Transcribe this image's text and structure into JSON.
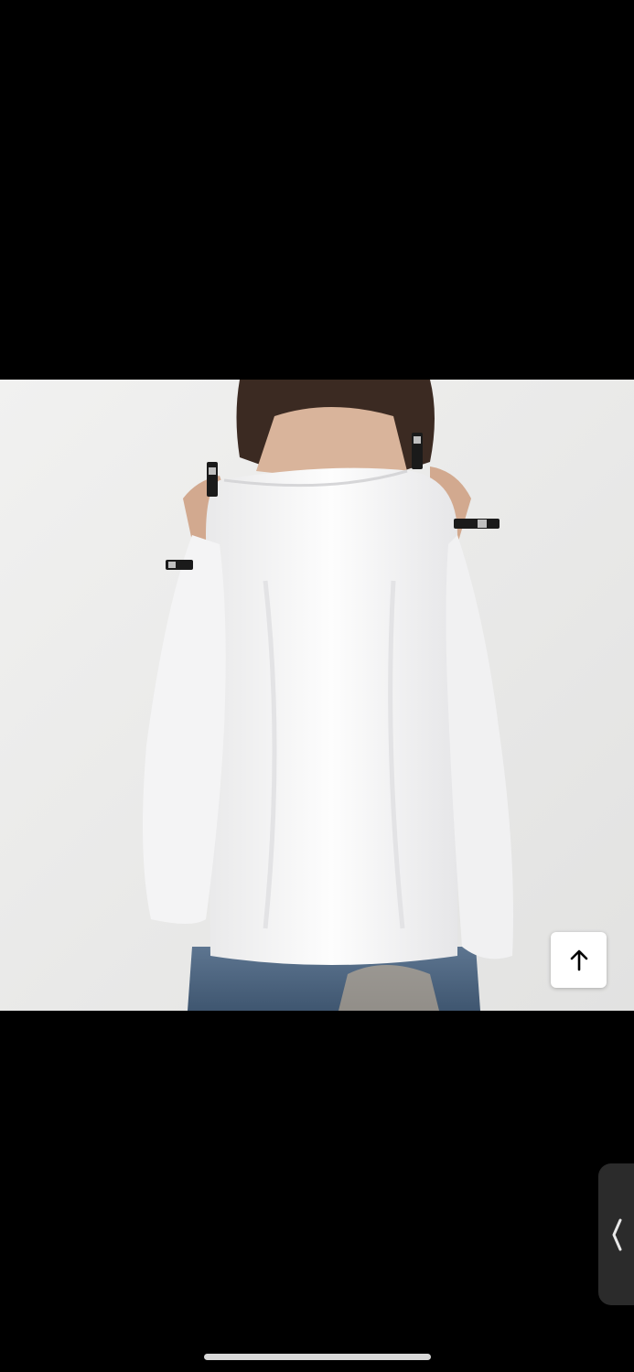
{
  "viewer": {
    "background_color": "#000000",
    "photo": {
      "subject": "product-photo",
      "shirt_color": "#ffffff",
      "strap_color": "#1a1a1a",
      "backdrop_color": "#ebebea"
    },
    "scroll_top_button": {
      "icon": "arrow-up-icon"
    },
    "side_handle": {
      "icon": "chevron-left-icon"
    },
    "home_indicator": {
      "color": "#d9d9d9"
    }
  }
}
